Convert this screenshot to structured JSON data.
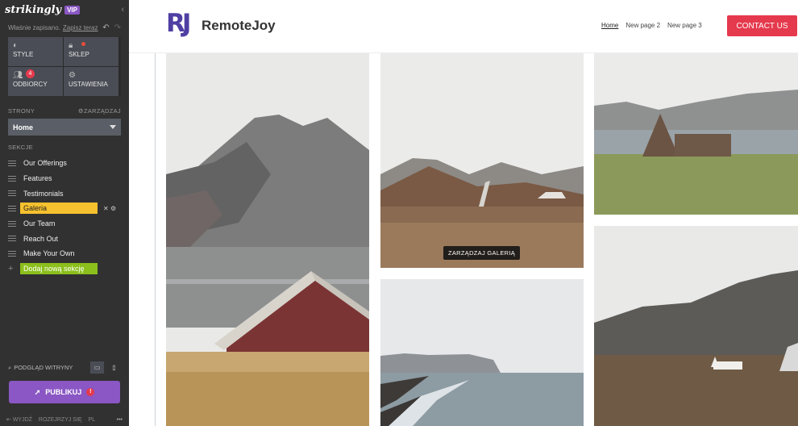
{
  "sidebar": {
    "brand": "strikingly",
    "vip": "VIP",
    "saved_text": "Właśnie zapisano.",
    "save_now": "Zapisz teraz",
    "tiles": [
      {
        "label": "STYLE",
        "icon": "palette-icon"
      },
      {
        "label": "SKLEP",
        "icon": "bag-icon"
      },
      {
        "label": "ODBIORCY",
        "icon": "people-icon",
        "badge": "4"
      },
      {
        "label": "USTAWIENIA",
        "icon": "gear-icon"
      }
    ],
    "pages_label": "STRONY",
    "manage_label": "ZARZĄDZAJ",
    "current_page": "Home",
    "sections_label": "SEKCJE",
    "sections": [
      "Our Offerings",
      "Features",
      "Testimonials",
      "Galeria",
      "Our Team",
      "Reach Out",
      "Make Your Own"
    ],
    "add_section": "Dodaj nową sekcję",
    "preview_label": "PODGLĄD WITRYNY",
    "publish_label": "PUBLIKUJ",
    "footer": {
      "exit": "WYJDŹ",
      "explore": "ROZEJRZYJ SIĘ",
      "lang": "PL"
    }
  },
  "site": {
    "logo_mark": "RJ",
    "name": "RemoteJoy",
    "nav": [
      "Home",
      "New page 2",
      "New page 3"
    ],
    "cta": "CONTACT US",
    "manage_gallery": "ZARZĄDZAJ GALERIĄ"
  },
  "colors": {
    "accent_purple": "#8a57c4",
    "cta_red": "#e5394d",
    "active_section": "#f6c12e",
    "add_green": "#8bbf1c"
  }
}
